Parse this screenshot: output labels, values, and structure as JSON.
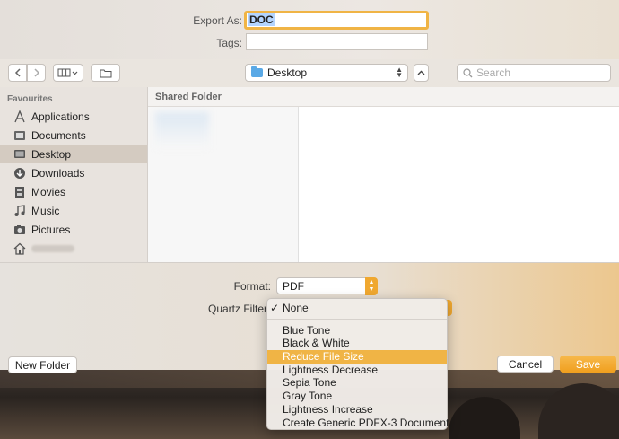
{
  "export": {
    "export_as_label": "Export As:",
    "export_as_value": "DOC",
    "tags_label": "Tags:",
    "tags_value": ""
  },
  "toolbar": {
    "location": "Desktop",
    "search_placeholder": "Search"
  },
  "sidebar": {
    "header": "Favourites",
    "items": [
      {
        "label": "Applications",
        "icon": "applications-icon"
      },
      {
        "label": "Documents",
        "icon": "documents-icon"
      },
      {
        "label": "Desktop",
        "icon": "desktop-icon",
        "selected": true
      },
      {
        "label": "Downloads",
        "icon": "downloads-icon"
      },
      {
        "label": "Movies",
        "icon": "movies-icon"
      },
      {
        "label": "Music",
        "icon": "music-icon"
      },
      {
        "label": "Pictures",
        "icon": "pictures-icon"
      },
      {
        "label": "",
        "icon": "home-icon"
      }
    ]
  },
  "browser": {
    "column_header": "Shared Folder"
  },
  "options": {
    "format_label": "Format:",
    "format_value": "PDF",
    "quartz_label": "Quartz Filter"
  },
  "quartz_menu": {
    "items": [
      {
        "label": "None",
        "checked": true
      },
      {
        "label": "Blue Tone"
      },
      {
        "label": "Black & White"
      },
      {
        "label": "Reduce File Size",
        "highlighted": true
      },
      {
        "label": "Lightness Decrease"
      },
      {
        "label": "Sepia Tone"
      },
      {
        "label": "Gray Tone"
      },
      {
        "label": "Lightness Increase"
      },
      {
        "label": "Create Generic PDFX-3 Document"
      }
    ]
  },
  "buttons": {
    "new_folder": "New Folder",
    "cancel": "Cancel",
    "save": "Save"
  },
  "colors": {
    "accent": "#f0a830",
    "selection_highlight": "#f0b445"
  }
}
